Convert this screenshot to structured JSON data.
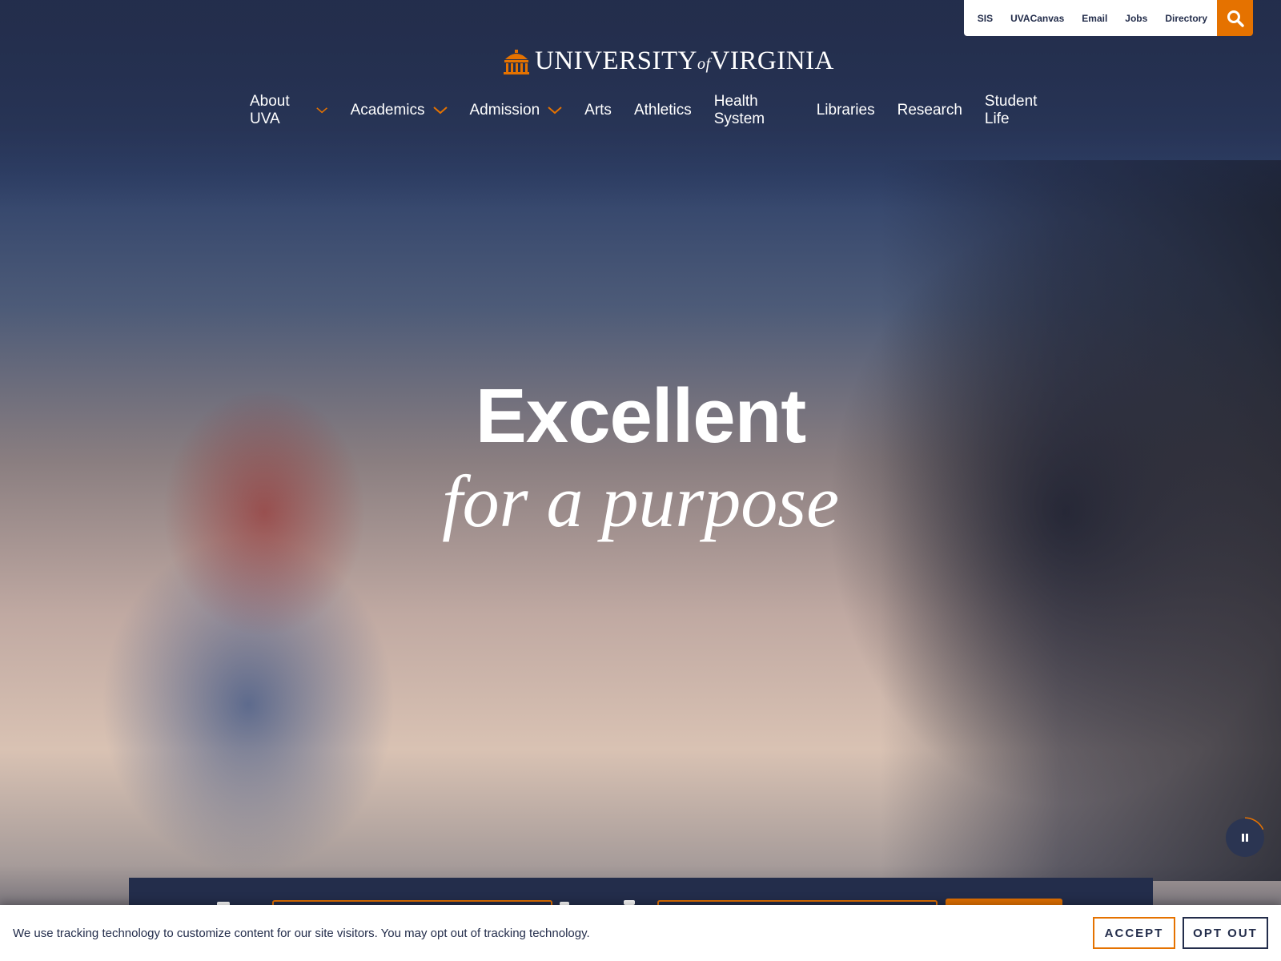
{
  "utility_nav": {
    "links": [
      "SIS",
      "UVACanvas",
      "Email",
      "Jobs",
      "Directory"
    ],
    "search_icon": "search-icon"
  },
  "logo": {
    "text_university": "UNIVERSITY",
    "text_of": "of",
    "text_virginia": "VIRGINIA",
    "icon": "rotunda-icon"
  },
  "main_nav": {
    "items": [
      {
        "label": "About UVA",
        "dropdown": true
      },
      {
        "label": "Academics",
        "dropdown": true
      },
      {
        "label": "Admission",
        "dropdown": true
      },
      {
        "label": "Arts",
        "dropdown": false
      },
      {
        "label": "Athletics",
        "dropdown": false
      },
      {
        "label": "Health System",
        "dropdown": false
      },
      {
        "label": "Libraries",
        "dropdown": false
      },
      {
        "label": "Research",
        "dropdown": false
      },
      {
        "label": "Student Life",
        "dropdown": false
      }
    ]
  },
  "hero": {
    "headline": "Excellent",
    "subheadline": "for a purpose",
    "pause_icon": "pause-icon"
  },
  "consent": {
    "message": "We use tracking technology to customize content for our site visitors. You may opt out of tracking technology.",
    "accept_label": "ACCEPT",
    "optout_label": "OPT OUT"
  },
  "colors": {
    "navy": "#232d4b",
    "orange": "#e57200",
    "white": "#ffffff"
  }
}
